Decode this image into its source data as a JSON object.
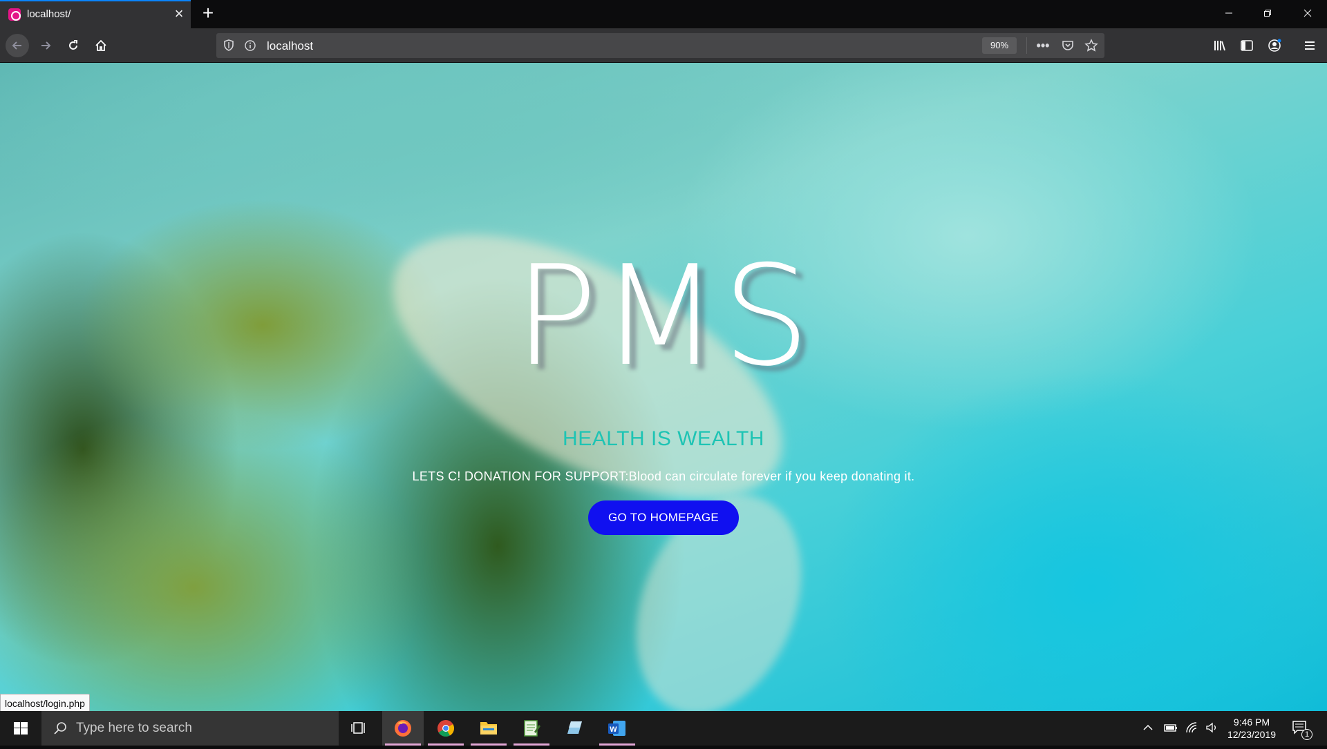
{
  "browser": {
    "tab_title": "localhost/",
    "url": "localhost",
    "zoom": "90%",
    "status_url": "localhost/login.php"
  },
  "hero": {
    "title": "PMS",
    "tagline": "HEALTH IS WEALTH",
    "description": "LETS C! DONATION FOR SUPPORT:Blood can circulate forever if you keep donating it.",
    "button_label": "GO TO HOMEPAGE"
  },
  "taskbar": {
    "search_placeholder": "Type here to search",
    "time": "9:46 PM",
    "date": "12/23/2019",
    "notification_count": "1"
  },
  "colors": {
    "accent_blue_button": "#1010f0",
    "tagline_teal": "#1ec4b4",
    "tab_indicator": "#0a84ff"
  }
}
